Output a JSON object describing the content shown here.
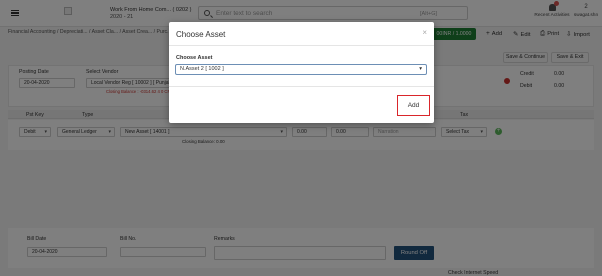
{
  "topbar": {
    "company_line1": "Work From Home Com... ( 0202 )",
    "company_line2": "2020 - 21",
    "search_placeholder": "Enter text to search",
    "search_shortcut": "[Alt+G]",
    "recent_activities": "Recent Activities",
    "user_name": "swagat.shn",
    "user_initial": "2"
  },
  "breadcrumb": {
    "text": "Financial Accounting  / Depreciati... / Asset Cla... / Asset Crea... / Purc..."
  },
  "toolbar": {
    "status_chip": "00INR / 1.0000",
    "add_label": "Add",
    "edit_label": "Edit",
    "print_label": "Print",
    "import_label": "Import",
    "save_continue_label": "Save & Continue",
    "save_exit_label": "Save & Exit"
  },
  "form": {
    "posting_date_label": "Posting Date",
    "posting_date_value": "20-04-2020",
    "vendor_label": "Select Vendor",
    "vendor_value": "Local Vendor Reg [ 10002 ] [ Punjab ]",
    "closing_balance_text": "Closing Balance : -0314.62 4 0 CR",
    "credit_label": "Credit",
    "credit_value": "0.00",
    "debit_label": "Debit",
    "debit_value": "0.00"
  },
  "grid": {
    "headers": [
      "Pst Key",
      "Type",
      "Tax"
    ],
    "row": {
      "pst_key": "Debit",
      "type": "General Ledger",
      "ledger": "New Asset [ 14001 ]",
      "amount1": "0.00",
      "amount2": "0.00",
      "narration_placeholder": "Narration",
      "tax": "Select Tax",
      "closing_balance": "Closing Balance: 0.00"
    }
  },
  "footer": {
    "bill_date_label": "Bill Date",
    "bill_date_value": "20-04-2020",
    "bill_no_label": "Bill No.",
    "remarks_label": "Remarks",
    "round_off_label": "Round Off",
    "check_text": "Check Internet Speed"
  },
  "modal": {
    "title": "Choose Asset",
    "close_glyph": "×",
    "field_label": "Choose Asset",
    "selected_value": "N.Asset 2 [ 1002 ]",
    "add_label": "Add"
  },
  "colors": {
    "accent_green": "#1e7e34",
    "primary_blue": "#23527c",
    "highlight_red": "#d9262b"
  }
}
